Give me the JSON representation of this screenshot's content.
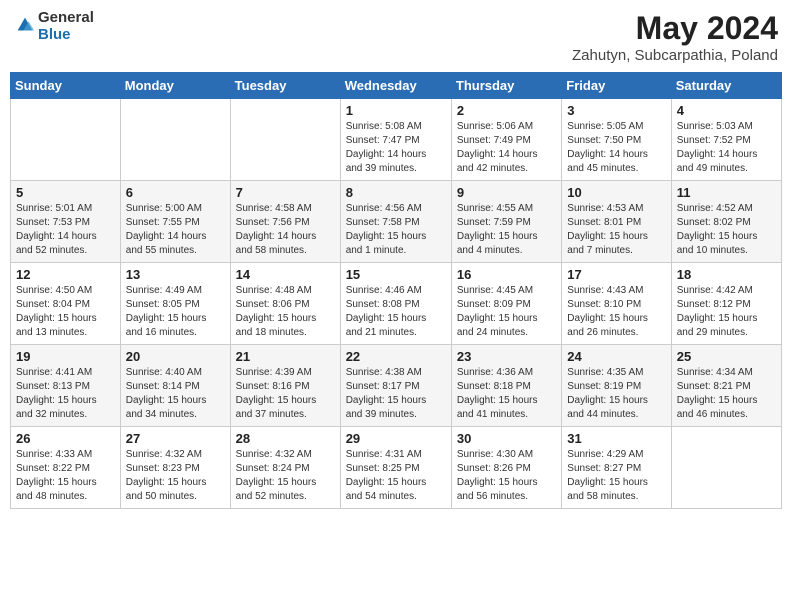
{
  "header": {
    "logo_general": "General",
    "logo_blue": "Blue",
    "month_year": "May 2024",
    "location": "Zahutyn, Subcarpathia, Poland"
  },
  "days_of_week": [
    "Sunday",
    "Monday",
    "Tuesday",
    "Wednesday",
    "Thursday",
    "Friday",
    "Saturday"
  ],
  "weeks": [
    [
      {
        "day": "",
        "info": ""
      },
      {
        "day": "",
        "info": ""
      },
      {
        "day": "",
        "info": ""
      },
      {
        "day": "1",
        "info": "Sunrise: 5:08 AM\nSunset: 7:47 PM\nDaylight: 14 hours\nand 39 minutes."
      },
      {
        "day": "2",
        "info": "Sunrise: 5:06 AM\nSunset: 7:49 PM\nDaylight: 14 hours\nand 42 minutes."
      },
      {
        "day": "3",
        "info": "Sunrise: 5:05 AM\nSunset: 7:50 PM\nDaylight: 14 hours\nand 45 minutes."
      },
      {
        "day": "4",
        "info": "Sunrise: 5:03 AM\nSunset: 7:52 PM\nDaylight: 14 hours\nand 49 minutes."
      }
    ],
    [
      {
        "day": "5",
        "info": "Sunrise: 5:01 AM\nSunset: 7:53 PM\nDaylight: 14 hours\nand 52 minutes."
      },
      {
        "day": "6",
        "info": "Sunrise: 5:00 AM\nSunset: 7:55 PM\nDaylight: 14 hours\nand 55 minutes."
      },
      {
        "day": "7",
        "info": "Sunrise: 4:58 AM\nSunset: 7:56 PM\nDaylight: 14 hours\nand 58 minutes."
      },
      {
        "day": "8",
        "info": "Sunrise: 4:56 AM\nSunset: 7:58 PM\nDaylight: 15 hours\nand 1 minute."
      },
      {
        "day": "9",
        "info": "Sunrise: 4:55 AM\nSunset: 7:59 PM\nDaylight: 15 hours\nand 4 minutes."
      },
      {
        "day": "10",
        "info": "Sunrise: 4:53 AM\nSunset: 8:01 PM\nDaylight: 15 hours\nand 7 minutes."
      },
      {
        "day": "11",
        "info": "Sunrise: 4:52 AM\nSunset: 8:02 PM\nDaylight: 15 hours\nand 10 minutes."
      }
    ],
    [
      {
        "day": "12",
        "info": "Sunrise: 4:50 AM\nSunset: 8:04 PM\nDaylight: 15 hours\nand 13 minutes."
      },
      {
        "day": "13",
        "info": "Sunrise: 4:49 AM\nSunset: 8:05 PM\nDaylight: 15 hours\nand 16 minutes."
      },
      {
        "day": "14",
        "info": "Sunrise: 4:48 AM\nSunset: 8:06 PM\nDaylight: 15 hours\nand 18 minutes."
      },
      {
        "day": "15",
        "info": "Sunrise: 4:46 AM\nSunset: 8:08 PM\nDaylight: 15 hours\nand 21 minutes."
      },
      {
        "day": "16",
        "info": "Sunrise: 4:45 AM\nSunset: 8:09 PM\nDaylight: 15 hours\nand 24 minutes."
      },
      {
        "day": "17",
        "info": "Sunrise: 4:43 AM\nSunset: 8:10 PM\nDaylight: 15 hours\nand 26 minutes."
      },
      {
        "day": "18",
        "info": "Sunrise: 4:42 AM\nSunset: 8:12 PM\nDaylight: 15 hours\nand 29 minutes."
      }
    ],
    [
      {
        "day": "19",
        "info": "Sunrise: 4:41 AM\nSunset: 8:13 PM\nDaylight: 15 hours\nand 32 minutes."
      },
      {
        "day": "20",
        "info": "Sunrise: 4:40 AM\nSunset: 8:14 PM\nDaylight: 15 hours\nand 34 minutes."
      },
      {
        "day": "21",
        "info": "Sunrise: 4:39 AM\nSunset: 8:16 PM\nDaylight: 15 hours\nand 37 minutes."
      },
      {
        "day": "22",
        "info": "Sunrise: 4:38 AM\nSunset: 8:17 PM\nDaylight: 15 hours\nand 39 minutes."
      },
      {
        "day": "23",
        "info": "Sunrise: 4:36 AM\nSunset: 8:18 PM\nDaylight: 15 hours\nand 41 minutes."
      },
      {
        "day": "24",
        "info": "Sunrise: 4:35 AM\nSunset: 8:19 PM\nDaylight: 15 hours\nand 44 minutes."
      },
      {
        "day": "25",
        "info": "Sunrise: 4:34 AM\nSunset: 8:21 PM\nDaylight: 15 hours\nand 46 minutes."
      }
    ],
    [
      {
        "day": "26",
        "info": "Sunrise: 4:33 AM\nSunset: 8:22 PM\nDaylight: 15 hours\nand 48 minutes."
      },
      {
        "day": "27",
        "info": "Sunrise: 4:32 AM\nSunset: 8:23 PM\nDaylight: 15 hours\nand 50 minutes."
      },
      {
        "day": "28",
        "info": "Sunrise: 4:32 AM\nSunset: 8:24 PM\nDaylight: 15 hours\nand 52 minutes."
      },
      {
        "day": "29",
        "info": "Sunrise: 4:31 AM\nSunset: 8:25 PM\nDaylight: 15 hours\nand 54 minutes."
      },
      {
        "day": "30",
        "info": "Sunrise: 4:30 AM\nSunset: 8:26 PM\nDaylight: 15 hours\nand 56 minutes."
      },
      {
        "day": "31",
        "info": "Sunrise: 4:29 AM\nSunset: 8:27 PM\nDaylight: 15 hours\nand 58 minutes."
      },
      {
        "day": "",
        "info": ""
      }
    ]
  ]
}
